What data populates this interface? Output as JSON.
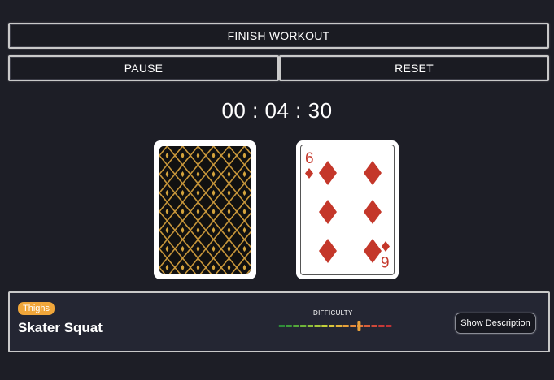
{
  "buttons": {
    "finish": "FINISH WORKOUT",
    "pause": "PAUSE",
    "reset": "RESET"
  },
  "timer": "00 : 04 : 30",
  "cards": {
    "back": {
      "pattern": "gold suits lattice"
    },
    "face": {
      "rank": "6",
      "suit": "diamonds",
      "color": "#c4372a"
    }
  },
  "exercise": {
    "muscle_group": "Thighs",
    "name": "Skater Squat",
    "difficulty_label": "DIFFICULTY",
    "difficulty_level": 0.71,
    "show_description": "Show Description"
  },
  "colors": {
    "background": "#1d1e26",
    "badge": "#f0a63a",
    "card_gold": "#d4a33c"
  }
}
